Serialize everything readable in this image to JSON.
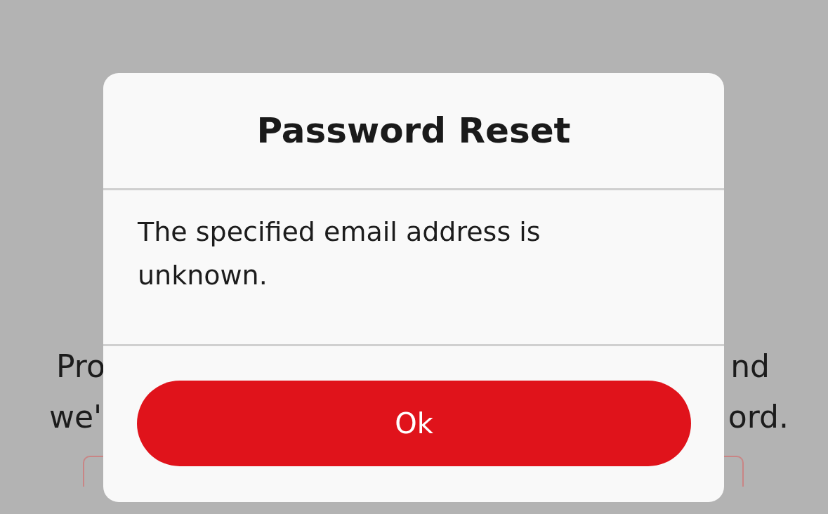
{
  "background": {
    "instruction_lines": [
      {
        "left": "Pro",
        "right": "nd"
      },
      {
        "left": "we'",
        "right": "ord."
      }
    ]
  },
  "dialog": {
    "title": "Password Reset",
    "message": "The specified email address is unknown.",
    "buttons": [
      {
        "label": "Ok"
      }
    ]
  }
}
